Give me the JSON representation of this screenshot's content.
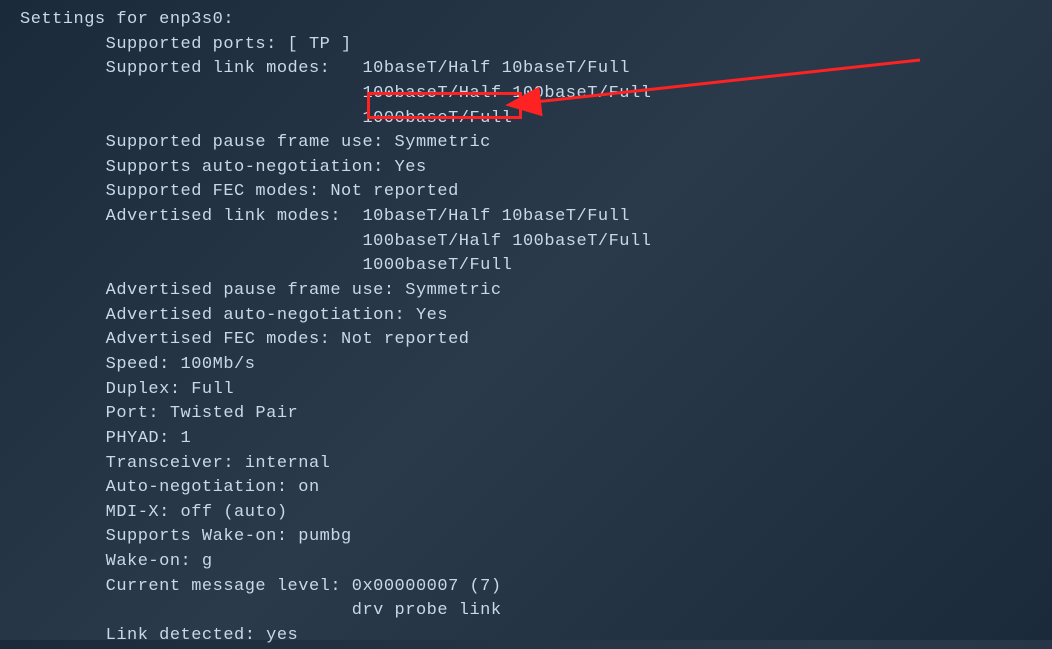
{
  "lines": {
    "l0": "Settings for enp3s0:",
    "l1": "        Supported ports: [ TP ]",
    "l2": "        Supported link modes:   10baseT/Half 10baseT/Full",
    "l3": "                                100baseT/Half 100baseT/Full",
    "l4": "                                1000baseT/Full",
    "l5": "        Supported pause frame use: Symmetric",
    "l6": "        Supports auto-negotiation: Yes",
    "l7": "        Supported FEC modes: Not reported",
    "l8": "        Advertised link modes:  10baseT/Half 10baseT/Full",
    "l9": "                                100baseT/Half 100baseT/Full",
    "l10": "                                1000baseT/Full",
    "l11": "        Advertised pause frame use: Symmetric",
    "l12": "        Advertised auto-negotiation: Yes",
    "l13": "        Advertised FEC modes: Not reported",
    "l14": "        Speed: 100Mb/s",
    "l15": "        Duplex: Full",
    "l16": "        Port: Twisted Pair",
    "l17": "        PHYAD: 1",
    "l18": "        Transceiver: internal",
    "l19": "        Auto-negotiation: on",
    "l20": "        MDI-X: off (auto)",
    "l21": "        Supports Wake-on: pumbg",
    "l22": "        Wake-on: g",
    "l23": "        Current message level: 0x00000007 (7)",
    "l24": "                               drv probe link",
    "l25": "",
    "l26": "        Link detected: yes"
  },
  "annotation": {
    "highlighted_value": "1000baseT/Full"
  }
}
